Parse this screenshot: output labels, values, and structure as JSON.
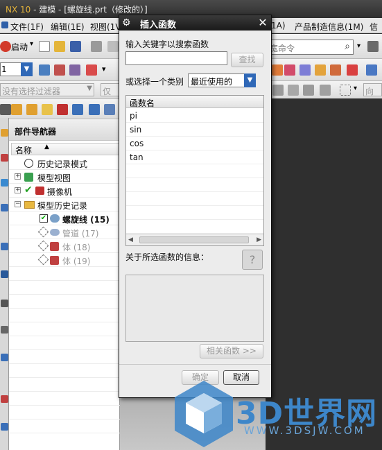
{
  "window": {
    "app": "NX 10",
    "title_rest": " - 建模 - [螺旋线.prt（修改的）]"
  },
  "menubar": {
    "items": [
      "文件(1F)",
      "编辑(1E)",
      "视图(1V)",
      "1A)",
      "产品制造信息(1M)",
      "信息"
    ]
  },
  "toolbar": {
    "start_label": "启动",
    "command_search_placeholder": "宽命令",
    "number_field": "1",
    "filter_placeholder": "没有选择过滤器",
    "filter2": "仅在",
    "filter3": "向网"
  },
  "navigator": {
    "title": "部件导航器",
    "column_name": "名称",
    "items": [
      {
        "label": "历史记录模式"
      },
      {
        "label": "模型视图"
      },
      {
        "label": "摄像机"
      },
      {
        "label": "模型历史记录"
      },
      {
        "label": "螺旋线 (15)"
      },
      {
        "label": "管道 (17)"
      },
      {
        "label": "体 (18)"
      },
      {
        "label": "体 (19)"
      }
    ]
  },
  "dialog": {
    "title": "插入函数",
    "search_label": "输入关键字以搜索函数",
    "search_value": "",
    "find_button": "查找",
    "category_label": "或选择一个类别",
    "category_selected": "最近使用的",
    "list_header": "函数名",
    "functions": [
      "pi",
      "sin",
      "cos",
      "tan"
    ],
    "info_label": "关于所选函数的信息：",
    "related_button": "相关函数 >>",
    "ok_button": "确定",
    "cancel_button": "取消"
  },
  "watermark": {
    "brand": "3D世界网",
    "url": "WWW.3DSJW.COM"
  },
  "colors": {
    "dialog_title_bg": "#1f1f1f",
    "watermark_blue": "#3d86c9"
  }
}
